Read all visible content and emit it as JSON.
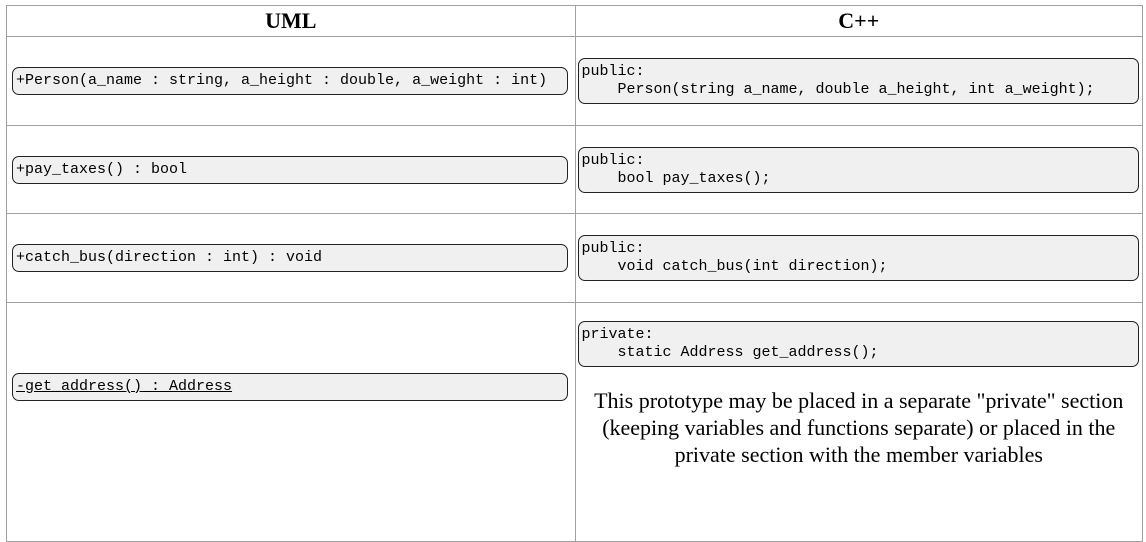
{
  "header": {
    "uml": "UML",
    "cpp": "C++"
  },
  "rows": [
    {
      "uml": "+Person(a_name : string, a_height : double, a_weight : int)",
      "cpp_access": "public:",
      "cpp_decl": "Person(string a_name, double a_height, int a_weight);"
    },
    {
      "uml": "+pay_taxes() : bool",
      "cpp_access": "public:",
      "cpp_decl": "bool pay_taxes();"
    },
    {
      "uml": "+catch_bus(direction : int) : void",
      "cpp_access": "public:",
      "cpp_decl": "void catch_bus(int direction);"
    },
    {
      "uml": "-get_address() : Address",
      "cpp_access": "private:",
      "cpp_decl": "static Address get_address();",
      "note": "This prototype may be placed in a separate \"private\" section (keeping variables and functions separate) or placed in the private section with the member variables"
    }
  ]
}
